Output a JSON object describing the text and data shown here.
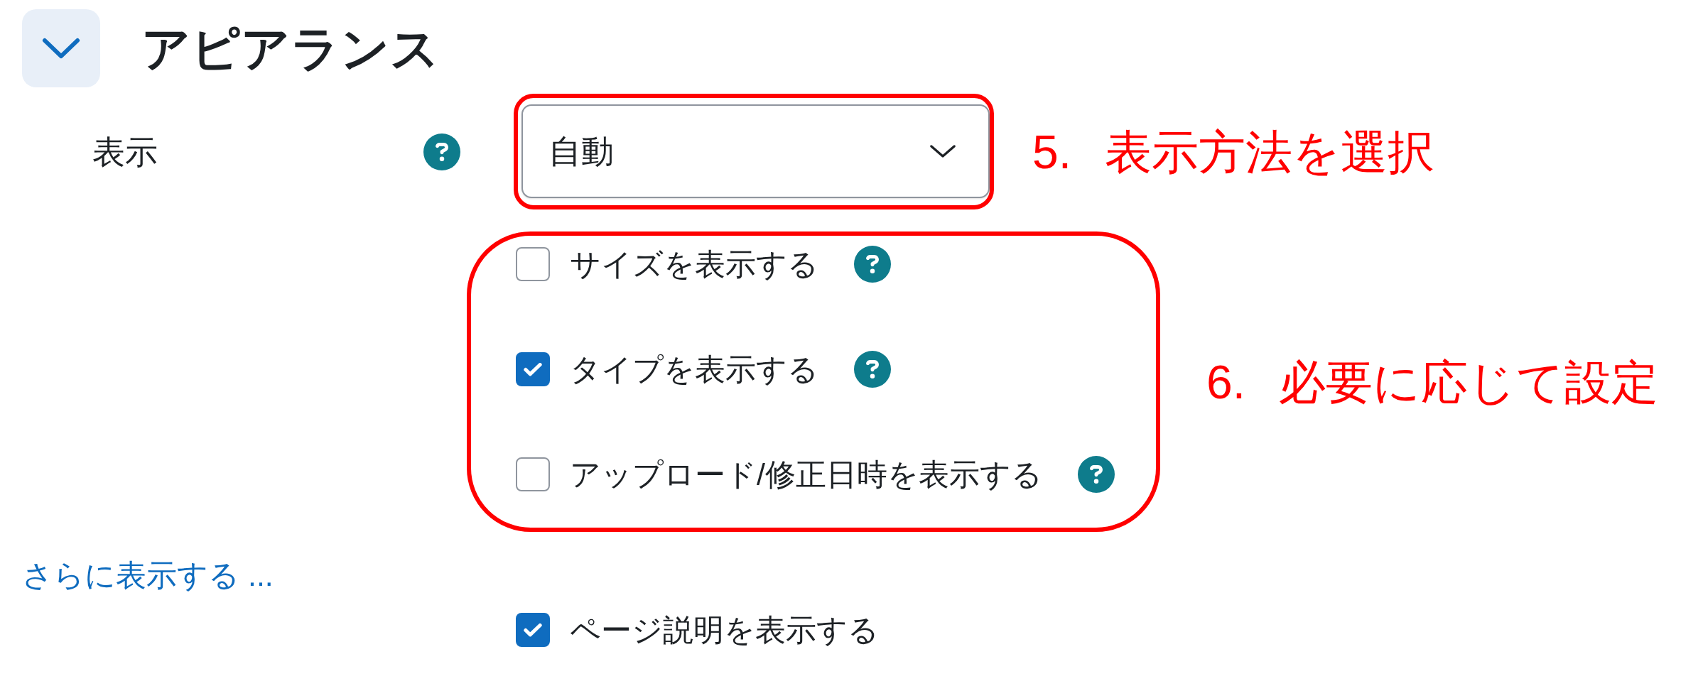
{
  "section": {
    "title": "アピアランス",
    "expanded": true
  },
  "display": {
    "label": "表示",
    "help": true,
    "value": "自動",
    "note": {
      "number": "5.",
      "text": "表示方法を選択"
    }
  },
  "options": {
    "items": [
      {
        "label": "サイズを表示する",
        "checked": false,
        "help": true
      },
      {
        "label": "タイプを表示する",
        "checked": true,
        "help": true
      },
      {
        "label": "アップロード/修正日時を表示する",
        "checked": false,
        "help": true
      }
    ],
    "note": {
      "number": "6.",
      "text": "必要に応じて設定"
    }
  },
  "more_link": "さらに表示する ...",
  "extra_options": [
    {
      "label": "ページ説明を表示する",
      "checked": true
    }
  ]
}
